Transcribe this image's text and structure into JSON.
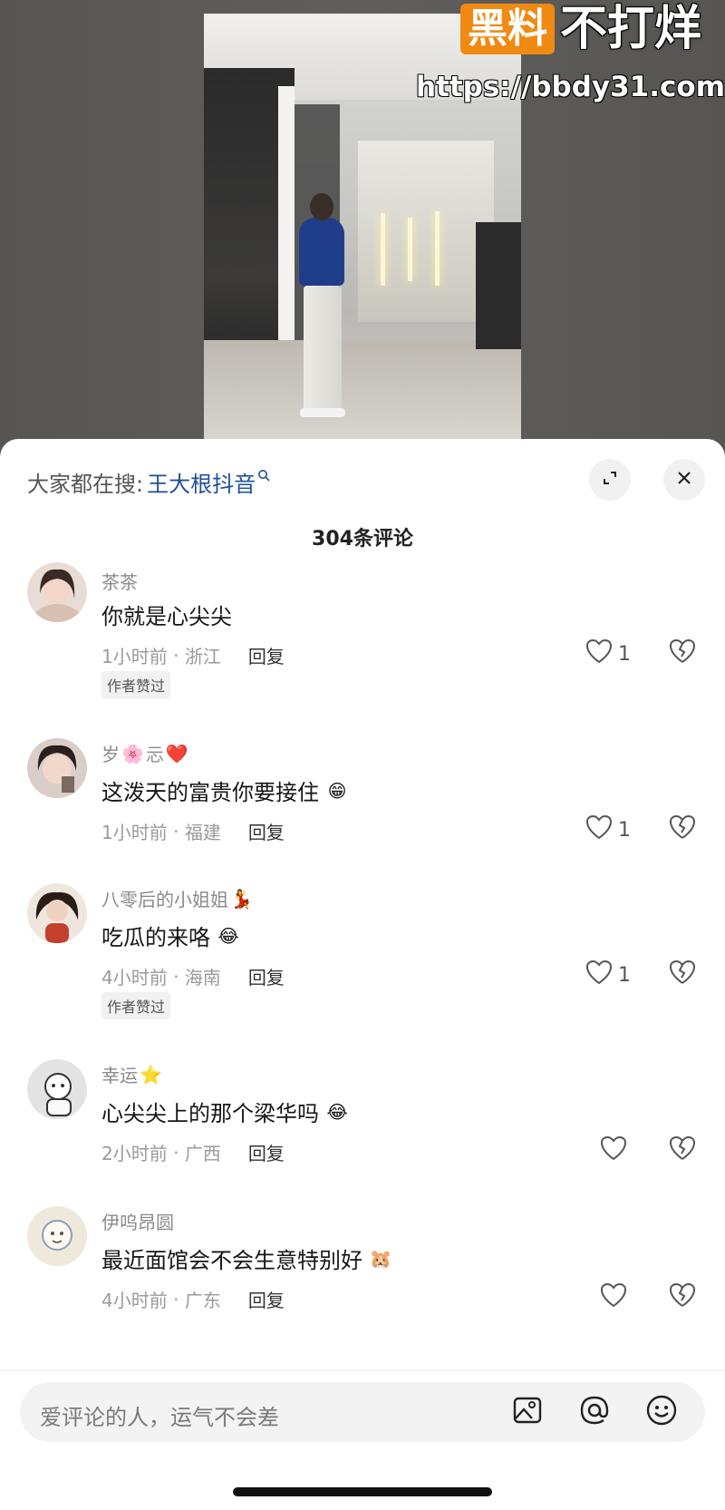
{
  "watermark": {
    "badge": "黑料",
    "title": "不打烊",
    "url": "https://bbdy31.com"
  },
  "sheet": {
    "search_prefix": "大家都在搜:",
    "search_keyword": "王大根抖音",
    "comment_count": "304条评论"
  },
  "comments": [
    {
      "user": "茶茶",
      "user_emoji": "",
      "text": "你就是心尖尖",
      "text_emoji": "",
      "time": "1小时前",
      "region": "浙江",
      "reply": "回复",
      "likes": "1",
      "badge": "作者赞过"
    },
    {
      "user": "岁",
      "user_emoji": "🌸",
      "user_suffix": "忈",
      "user_heart": "❤️",
      "text": "这泼天的富贵你要接住",
      "text_emoji": "😁",
      "time": "1小时前",
      "region": "福建",
      "reply": "回复",
      "likes": "1",
      "badge": ""
    },
    {
      "user": "八零后的小姐姐",
      "user_emoji": "💃",
      "text": "吃瓜的来咯",
      "text_emoji": "😂",
      "time": "4小时前",
      "region": "海南",
      "reply": "回复",
      "likes": "1",
      "badge": "作者赞过"
    },
    {
      "user": "幸运",
      "user_emoji": "⭐",
      "text": "心尖尖上的那个梁华吗",
      "text_emoji": "😂",
      "time": "2小时前",
      "region": "广西",
      "reply": "回复",
      "likes": "",
      "badge": ""
    },
    {
      "user": "伊呜昂圆",
      "user_emoji": "",
      "text": "最近面馆会不会生意特别好",
      "text_emoji": "🐹",
      "time": "4小时前",
      "region": "广东",
      "reply": "回复",
      "likes": "",
      "badge": ""
    }
  ],
  "input": {
    "placeholder": "爱评论的人，运气不会差"
  },
  "icons": {
    "expand": "expand-icon",
    "close": "close-icon",
    "like": "heart-icon",
    "dislike": "broken-heart-icon",
    "image": "image-icon",
    "mention": "at-icon",
    "emoji": "smiley-icon"
  },
  "colors": {
    "keyword": "#1f4f9b",
    "watermark_badge": "#f08a12"
  }
}
